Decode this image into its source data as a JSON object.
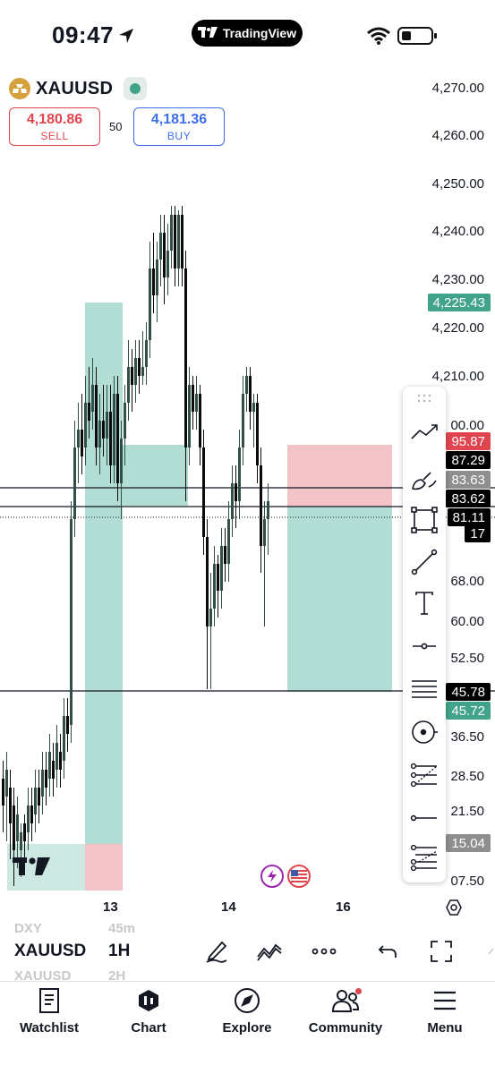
{
  "status_bar": {
    "time": "09:47",
    "app_pill": "TradingView"
  },
  "symbol": {
    "name": "XAUUSD",
    "sell_price": "4,180.86",
    "sell_label": "SELL",
    "spread": "50",
    "buy_price": "4,181.36",
    "buy_label": "BUY"
  },
  "price_axis": {
    "labels": [
      "4,270.00",
      "4,260.00",
      "4,250.00",
      "4,240.00",
      "4,230.00",
      "4,220.00",
      "4,210.00",
      "00.00",
      "68.00",
      "60.00",
      "52.50",
      "36.50",
      "28.50",
      "21.50",
      "07.50"
    ],
    "tags": [
      {
        "text": "4,225.43",
        "color": "#41a38a"
      },
      {
        "text": "95.87",
        "color": "#e0454f"
      },
      {
        "text": "87.29",
        "color": "#000000"
      },
      {
        "text": "83.63",
        "color": "#8e8e8e"
      },
      {
        "text": "83.62",
        "color": "#000000"
      },
      {
        "text": "81.11",
        "color": "#000000"
      },
      {
        "text": "17",
        "color": "#000000"
      },
      {
        "text": "45.78",
        "color": "#000000"
      },
      {
        "text": "45.72",
        "color": "#41a38a"
      },
      {
        "text": "15.04",
        "color": "#8e8e8e"
      }
    ]
  },
  "time_axis": [
    "13",
    "14",
    "16"
  ],
  "bottom_toolbar": {
    "symbol": "XAUUSD",
    "timeframe": "1H",
    "ghost_symbol_above": "DXY",
    "ghost_tf_above": "45m",
    "ghost_symbol_below": "XAUUSD",
    "ghost_tf_below": "2H"
  },
  "nav": [
    "Watchlist",
    "Chart",
    "Explore",
    "Community",
    "Menu"
  ],
  "colors": {
    "bull": "#2f4f47",
    "bear": "#0b0b0b",
    "profit_zone": "#b2ddd4",
    "loss_zone": "#f2c4c8",
    "accent": "#41a38a"
  },
  "drawing_tools": [
    "trend-angle-icon",
    "brush-icon",
    "rectangle-icon",
    "trend-line-icon",
    "text-icon",
    "horizontal-ray-icon",
    "fib-levels-icon",
    "circle-target-icon",
    "pitchfork-icon",
    "horizontal-line-icon",
    "gann-icon"
  ]
}
